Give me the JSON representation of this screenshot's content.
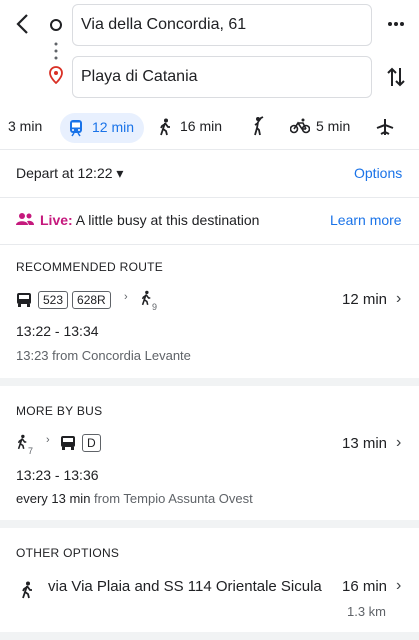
{
  "origin": {
    "value": "Via della Concordia, 61"
  },
  "destination": {
    "value": "Playa di Catania"
  },
  "modes": [
    {
      "icon": "car-icon",
      "label": "3 min",
      "selected": false
    },
    {
      "icon": "transit-icon",
      "label": "12 min",
      "selected": true
    },
    {
      "icon": "walk-icon",
      "label": "16 min",
      "selected": false
    },
    {
      "icon": "ride-hail-icon",
      "label": "",
      "selected": false
    },
    {
      "icon": "bike-icon",
      "label": "5 min",
      "selected": false
    },
    {
      "icon": "flight-icon",
      "label": "",
      "selected": false
    }
  ],
  "depart": {
    "label": "Depart at 12:22 ▾",
    "options": "Options"
  },
  "live": {
    "prefix": "Live:",
    "text": " A little busy at this destination",
    "link": "Learn more"
  },
  "recommended": {
    "title": "RECOMMENDED ROUTE",
    "lines": [
      "523",
      "628R"
    ],
    "walk_minutes": "9",
    "duration": "12 min",
    "times": "13:22 - 13:34",
    "from": "13:23 from Concordia Levante"
  },
  "bus": {
    "title": "MORE BY BUS",
    "walk_minutes": "7",
    "line": "D",
    "duration": "13 min",
    "times": "13:23 - 13:36",
    "frequency": "every 13 min",
    "from": " from Tempio Assunta Ovest"
  },
  "other": {
    "title": "OTHER OPTIONS",
    "route": "via Via Plaia and SS 114 Orientale Sicula",
    "duration": "16 min",
    "distance": "1.3 km"
  },
  "colors": {
    "accent": "#1a73e8",
    "live": "#c5197d",
    "selected_bg": "#e8f0fe"
  }
}
